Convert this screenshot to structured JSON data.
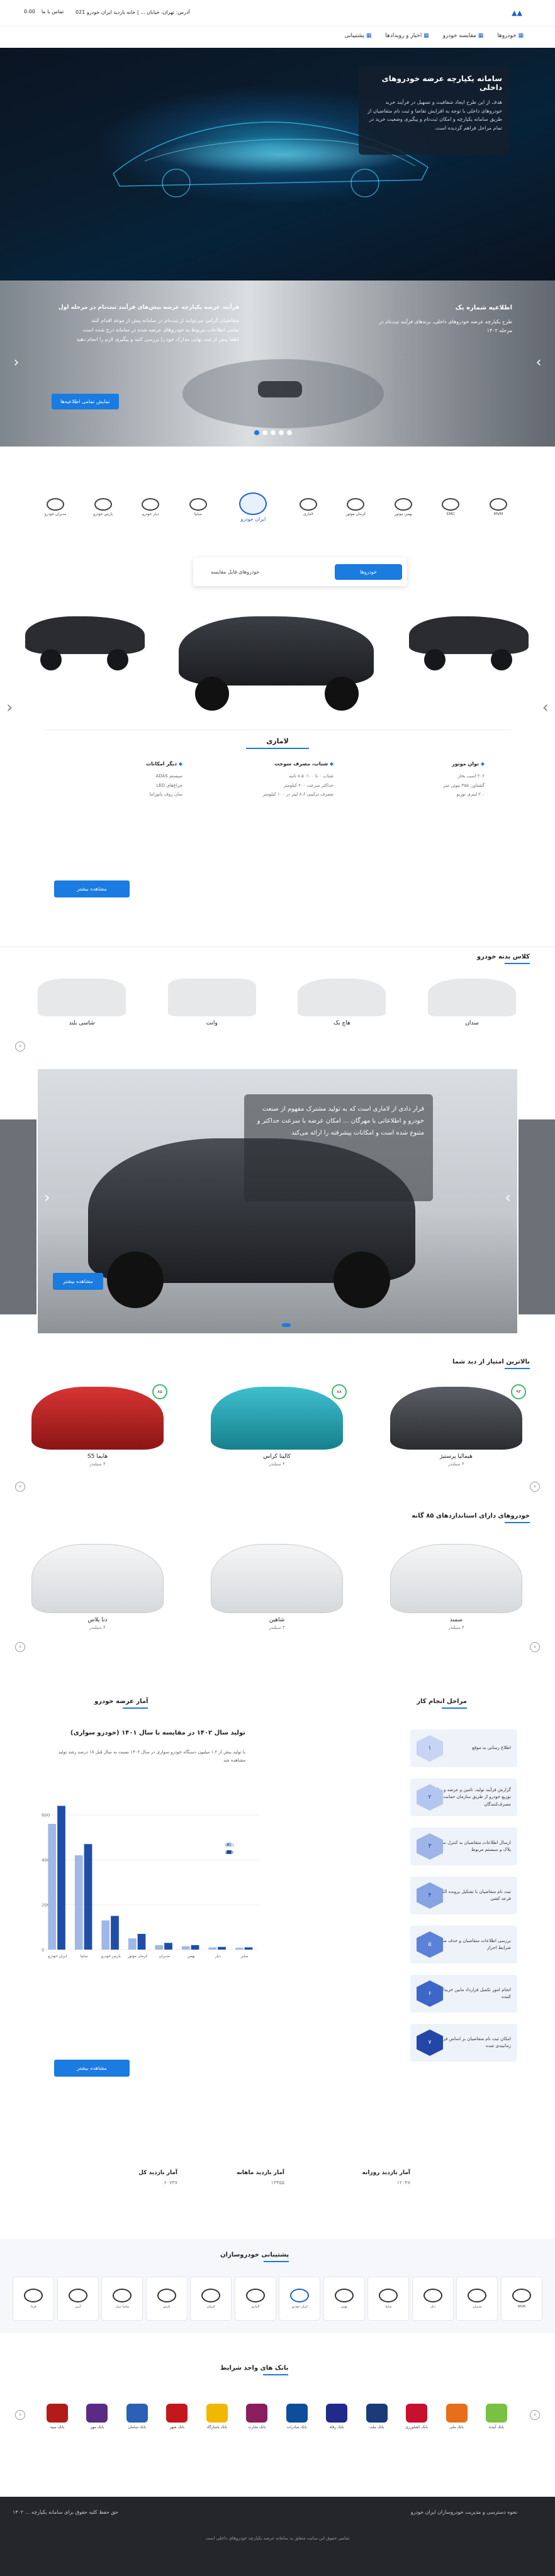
{
  "header": {
    "logo": "logo",
    "message": "آدرس: تهران، خیابان ... | خانه بازدید ایران خودرو 021",
    "phone_label": "0.00",
    "phone_number": "تماس با ما"
  },
  "nav": {
    "items": [
      "خودروها",
      "مقایسه خودرو",
      "اخبار و رویدادها",
      "پشتیبانی"
    ]
  },
  "hero": {
    "title": "سامانه یکپارچه عرضه خودروهای داخلی",
    "body": "هدف از این طرح ایجاد شفافیت و تسهیل در فرآیند خرید خودروهای داخلی با توجه به افزایش تقاضا و ثبت نام متقاضیان از طریق سامانه یکپارچه و امکان ثبت‌نام و پیگیری وضعیت خرید در تمام مراحل فراهم گردیده است."
  },
  "slider2": {
    "right_title": "اطلاعیه شماره یک",
    "right_body": "طرح یکپارچه عرضه خودروهای داخلی، برندهای فرآیند ثبت‌نام در مرحله ۱۴۰۲",
    "left_title": "فرآیند عرضه یکپارچه عرضه پیش‌های فرآیند ثبت‌نام در مرحله اول",
    "left_lines": [
      "متقاضیان گرامی می‌توانند از ثبت‌نام در سامانه پیش از موعد اقدام کنند",
      "تمامی اطلاعات مربوط به خودروهای عرضه شده در سامانه درج شده است",
      "لطفا پیش از ثبت نهایی مدارک خود را بررسی کنید و پیگیری لازم را انجام دهید"
    ],
    "cta": "نمایش تمامی اطلاعیه‌ها"
  },
  "brands": [
    {
      "icon": "mvm-icon",
      "label": "MVM"
    },
    {
      "icon": "emc-icon",
      "label": "EMC"
    },
    {
      "icon": "bahman-icon",
      "label": "بهمن موتور"
    },
    {
      "icon": "kerman-icon",
      "label": "کرمان موتور"
    },
    {
      "icon": "lamari-icon",
      "label": "لاماری"
    },
    {
      "icon": "iran-khodro-icon",
      "label": "ایران خودرو"
    },
    {
      "icon": "saipa-icon",
      "label": "سایپا"
    },
    {
      "icon": "diar-icon",
      "label": "دیار خودرو"
    },
    {
      "icon": "pars-icon",
      "label": "پارس خودرو"
    },
    {
      "icon": "modiran-icon",
      "label": "مدیران خودرو"
    }
  ],
  "tabs": {
    "active": "خودروها",
    "other": "خودروهای قابل مقایسه"
  },
  "featured": {
    "name": "لاماری",
    "specs": [
      {
        "title": "توان موتور",
        "lines": [
          "۲۰۶ اسب بخار",
          "گشتاور: ۳۵۵ نیوتن متر",
          "۲.۰ لیتری توربو"
        ]
      },
      {
        "title": "شتاب، مصرف سوخت",
        "lines": [
          "شتاب ۰ تا ۱۰۰: ۸.۵ ثانیه",
          "حداکثر سرعت ۲۰۰ کیلومتر",
          "مصرف ترکیبی ۸.۶ لیتر در ۱۰۰ کیلومتر"
        ]
      },
      {
        "title": "دیگر امکانات",
        "lines": [
          "سیستم ADAS",
          "چراغ‌های LED",
          "سان روف پانوراما"
        ]
      }
    ],
    "cta": "مشاهده بیشتر"
  },
  "bodies": {
    "title": "کلاس بدنه خودرو",
    "items": [
      "سدان",
      "هاچ بک",
      "وانت",
      "شاسی بلند"
    ]
  },
  "promo": {
    "body": "قرار دادی از لاماری است که به تولید مشترک مفهوم از صنعت خودرو و اطلاعاتی با مهرگان ... امکان عرضه با سرعت حداکثر و متنوع شده است و امکانات پیشرفته را ارائه می‌کند",
    "cta": "مشاهده بیشتر"
  },
  "ranked": {
    "title": "بالاترین امتیاز از دید شما",
    "cars": [
      {
        "name": "هیمالیا پرستیژ",
        "sub": "۴ سیلندر",
        "score": "۹۳"
      },
      {
        "name": "کالیتا کراس",
        "sub": "۴ سیلندر",
        "score": "۸۸"
      },
      {
        "name": "هایما S5",
        "sub": "۴ سیلندر",
        "score": "۸۵"
      }
    ]
  },
  "standard": {
    "title": "خودروهای دارای استانداردهای ۸۵ گانه",
    "cars": [
      {
        "name": "سمند",
        "sub": "۴ سیلندر"
      },
      {
        "name": "شاهین",
        "sub": "۴ سیلندر"
      },
      {
        "name": "دنا پلاس",
        "sub": "۴ سیلندر"
      }
    ]
  },
  "steps": {
    "title": "مراحل انجام کار",
    "items": [
      "اطلاع رسانی به موقع",
      "گزارش فرآیند تولید، تامین و عرضه و نظارت بر توزیع خودرو از طریق سازمان حمایت از مصرف‌کنندگان",
      "ارسال اطلاعات متقاضیان به کنترل ساختار اعتبار پلاک و سیستم مربوط",
      "ثبت نام متقاضیان با تشکیل پرونده الکترونیکی و قرعه کشی",
      "بررسی اطلاعات متقاضیان و حذف متقاضیان فاقد شرایط احراز",
      "انجام امور تکمیل قرارداد مابین خریدار و عرضه کننده",
      "امکان ثبت نام متقاضیان بر اساس فرآیندهای زمانبندی شده"
    ]
  },
  "stats_chart": {
    "title": "آمار عرضه خودرو",
    "subtitle": "تولید سال ۱۴۰۲ در مقایسه با سال ۱۴۰۱ (خودرو سواری)",
    "desc": "با تولید بیش از ۱.۲ میلیون دستگاه خودرو سواری در سال ۱۴۰۲ نسبت به سال قبل ۱۸ درصد رشد تولید مشاهده شد",
    "cta": "مشاهده بیشتر"
  },
  "chart_data": {
    "type": "bar",
    "categories": [
      "ایران خودرو",
      "سایپا",
      "پارس خودرو",
      "کرمان موتور",
      "مدیران",
      "بهمن",
      "دیار",
      "سایر"
    ],
    "series": [
      {
        "name": "۱۴۰۱",
        "values": [
          560,
          420,
          130,
          50,
          20,
          15,
          10,
          8
        ]
      },
      {
        "name": "۱۴۰۲",
        "values": [
          640,
          470,
          150,
          70,
          30,
          20,
          12,
          10
        ]
      }
    ],
    "ylim": [
      0,
      700
    ],
    "colors": [
      "#9fb8e8",
      "#1f4ea8"
    ]
  },
  "stats": [
    {
      "label": "آمار بازدید روزانه",
      "value": "۱۲۰۴۷"
    },
    {
      "label": "آمار بازدید ماهانه",
      "value": "۱۳۴۵۵"
    },
    {
      "label": "آمار بازدید کل",
      "value": "۶۰۷۳۷"
    }
  ],
  "supporters": {
    "title": "پشتیبانی خودروسازان",
    "items": [
      "MVM",
      "مدیران",
      "دیار",
      "سایپا",
      "بهمن",
      "ایران خودرو",
      "لاماری",
      "کرمان",
      "پارس",
      "سایپا دیزل",
      "آرین",
      "فردا"
    ]
  },
  "banks": {
    "title": "بانک های واجد شرایط",
    "items": [
      "بانک آینده",
      "بانک ملی",
      "بانک کشاورزی",
      "بانک ملت",
      "بانک رفاه",
      "بانک صادرات",
      "بانک تجارت",
      "بانک پاسارگاد",
      "بانک شهر",
      "بانک سامان",
      "بانک مهر",
      "بانک سپه"
    ]
  },
  "footer": {
    "right": "نحوه دسترسی و مدیریت خودروسازان ایران خودرو",
    "left": "حق حفظ کلیه حقوق برای سامانه یکپارچه ... ۱۴۰۲",
    "bottom": "تمامی حقوق این سایت متعلق به سامانه عرضه یکپارچه خودروهای داخلی است"
  }
}
